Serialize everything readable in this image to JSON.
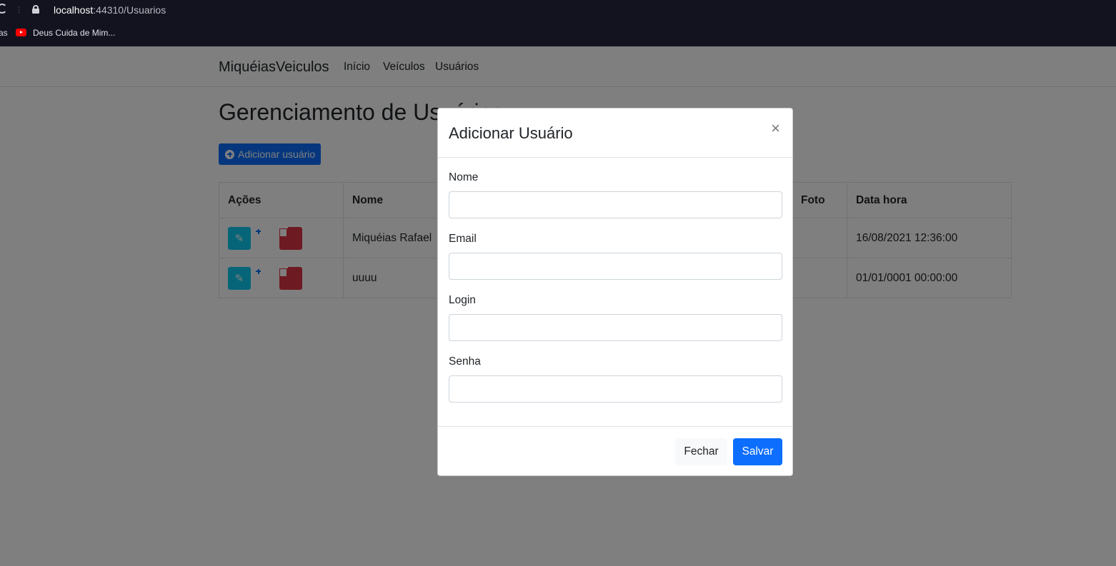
{
  "browser": {
    "url_host": "localhost",
    "url_rest": ":44310/Usuarios",
    "bookmark_prev": "as",
    "bookmark_label": "Deus Cuida de Mim..."
  },
  "navbar": {
    "brand": "MiquéiasVeiculos",
    "links": [
      "Início",
      "Veículos",
      "Usuários"
    ]
  },
  "page": {
    "title": "Gerenciamento de Usuários",
    "add_button": "Adicionar usuário"
  },
  "table": {
    "headers": [
      "Ações",
      "Nome",
      "Foto",
      "Data hora"
    ],
    "rows": [
      {
        "nome": "Miquéias Rafael",
        "data_hora": "16/08/2021 12:36:00"
      },
      {
        "nome": "uuuu",
        "data_hora": "01/01/0001 00:00:00"
      }
    ]
  },
  "modal": {
    "title": "Adicionar Usuário",
    "close_symbol": "×",
    "fields": [
      {
        "label": "Nome",
        "value": ""
      },
      {
        "label": "Email",
        "value": ""
      },
      {
        "label": "Login",
        "value": ""
      },
      {
        "label": "Senha",
        "value": ""
      }
    ],
    "close_button": "Fechar",
    "save_button": "Salvar"
  },
  "colors": {
    "primary": "#0d6efd",
    "info": "#0dcaf0",
    "danger": "#dc3545",
    "chrome_bg": "#13131f"
  },
  "icons": {
    "edit": "pencil-icon",
    "add": "plus-circle-icon",
    "delete": "trash-icon"
  }
}
